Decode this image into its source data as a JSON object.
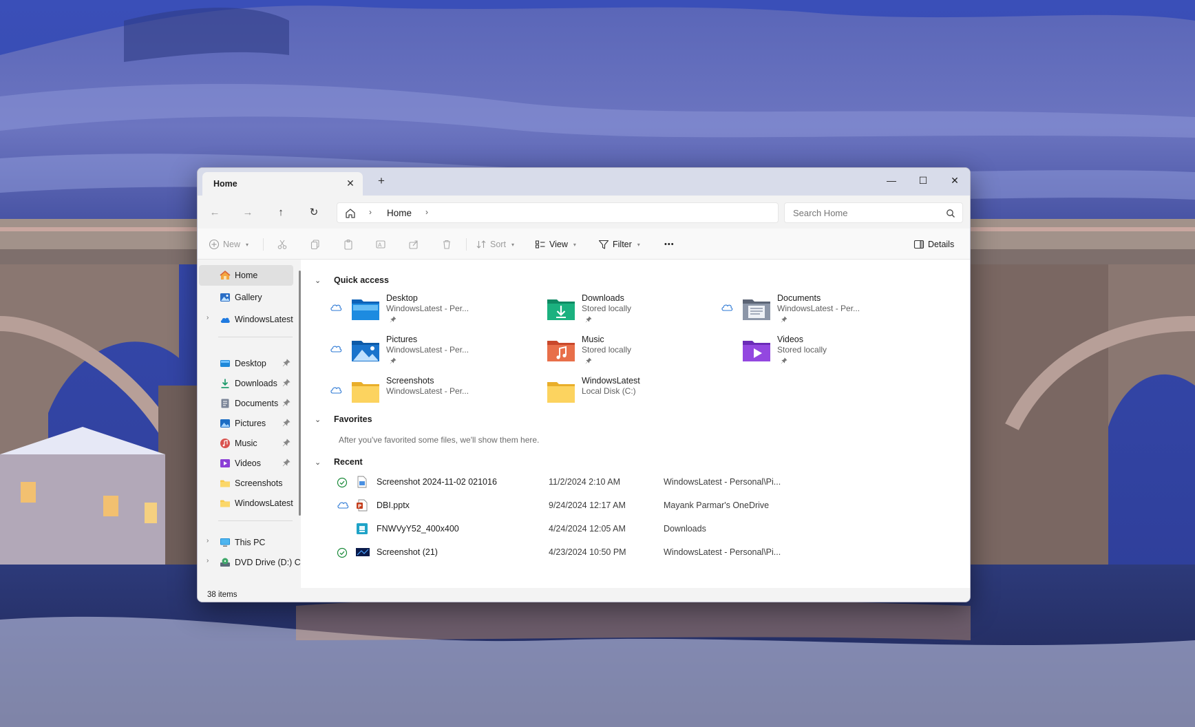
{
  "window": {
    "tab_title": "Home",
    "tab_close": "✕",
    "tab_new": "+",
    "minimize": "—",
    "maximize": "☐",
    "close": "✕"
  },
  "navigation": {
    "back": "←",
    "forward": "→",
    "up": "↑",
    "refresh": "↻",
    "breadcrumb": "Home",
    "separator": "›",
    "search_placeholder": "Search Home"
  },
  "commands": {
    "new": "New",
    "sort": "Sort",
    "view": "View",
    "filter": "Filter",
    "more": "•••",
    "details": "Details"
  },
  "sidebar": {
    "top": [
      {
        "label": "Home",
        "icon": "home-icon",
        "active": true
      },
      {
        "label": "Gallery",
        "icon": "gallery-icon"
      },
      {
        "label": "WindowsLatest",
        "icon": "onedrive-cloud-icon",
        "expandable": true
      }
    ],
    "pinned": [
      {
        "label": "Desktop",
        "icon": "desktop-folder-icon"
      },
      {
        "label": "Downloads",
        "icon": "downloads-icon"
      },
      {
        "label": "Documents",
        "icon": "documents-icon"
      },
      {
        "label": "Pictures",
        "icon": "pictures-icon"
      },
      {
        "label": "Music",
        "icon": "music-icon"
      },
      {
        "label": "Videos",
        "icon": "videos-icon"
      },
      {
        "label": "Screenshots",
        "icon": "folder-icon"
      },
      {
        "label": "WindowsLatest",
        "icon": "folder-icon"
      }
    ],
    "devices": [
      {
        "label": "This PC",
        "icon": "this-pc-icon"
      },
      {
        "label": "DVD Drive (D:) C",
        "icon": "dvd-drive-icon"
      }
    ]
  },
  "sections": {
    "quick_access": "Quick access",
    "favorites": "Favorites",
    "favorites_empty": "After you've favorited some files, we'll show them here.",
    "recent": "Recent"
  },
  "quick_access": [
    {
      "name": "Desktop",
      "sub": "WindowsLatest - Per...",
      "icon": "desktop-folder-icon",
      "cloud": true,
      "pinned": true
    },
    {
      "name": "Downloads",
      "sub": "Stored locally",
      "icon": "downloads-folder-icon",
      "cloud": false,
      "pinned": true
    },
    {
      "name": "Documents",
      "sub": "WindowsLatest - Per...",
      "icon": "documents-folder-icon",
      "cloud": true,
      "pinned": true
    },
    {
      "name": "Pictures",
      "sub": "WindowsLatest - Per...",
      "icon": "pictures-folder-icon",
      "cloud": true,
      "pinned": true
    },
    {
      "name": "Music",
      "sub": "Stored locally",
      "icon": "music-folder-icon",
      "cloud": false,
      "pinned": true
    },
    {
      "name": "Videos",
      "sub": "Stored locally",
      "icon": "videos-folder-icon",
      "cloud": false,
      "pinned": true
    },
    {
      "name": "Screenshots",
      "sub": "WindowsLatest - Per...",
      "icon": "folder-icon",
      "cloud": true,
      "pinned": false
    },
    {
      "name": "WindowsLatest",
      "sub": "Local Disk (C:)",
      "icon": "folder-icon",
      "cloud": false,
      "pinned": false
    }
  ],
  "recent": [
    {
      "name": "Screenshot 2024-11-02 021016",
      "date": "11/2/2024 2:10 AM",
      "location": "WindowsLatest - Personal\\Pi...",
      "status": "synced-check-icon",
      "icon": "image-file-icon"
    },
    {
      "name": "DBI.pptx",
      "date": "9/24/2024 12:17 AM",
      "location": "Mayank Parmar's OneDrive",
      "status": "cloud-only-icon",
      "icon": "powerpoint-file-icon"
    },
    {
      "name": "FNWVyY52_400x400",
      "date": "4/24/2024 12:05 AM",
      "location": "Downloads",
      "status": "",
      "icon": "image-file-icon"
    },
    {
      "name": "Screenshot (21)",
      "date": "4/23/2024 10:50 PM",
      "location": "WindowsLatest - Personal\\Pi...",
      "status": "synced-check-icon",
      "icon": "screenshot-thumbnail-icon"
    }
  ],
  "status_bar": {
    "items": "38 items"
  },
  "colors": {
    "accent": "#0067c0",
    "titlebar": "#d8dcea",
    "folder_yellow": "#f7c94b",
    "sync_green": "#1b8a3a"
  }
}
